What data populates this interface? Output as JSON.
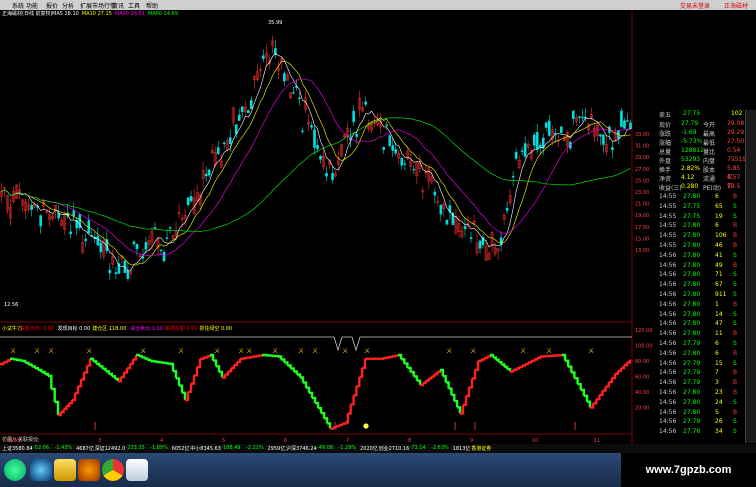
{
  "menu": {
    "items": [
      "系统",
      "功能",
      "报价",
      "分析",
      "扩展市场行情",
      "资讯",
      "工具",
      "帮助"
    ],
    "right_items": [
      "交易未登录",
      "正海磁材"
    ]
  },
  "main_chart": {
    "title": "正海磁材(日线 前复权)",
    "indicators": [
      {
        "label": "MA5 28.10",
        "color": "#ffffff"
      },
      {
        "label": "MA10 27.15",
        "color": "#ffff00"
      },
      {
        "label": "MA20 28.51",
        "color": "#ff00ff"
      },
      {
        "label": "MA60 24.69",
        "color": "#00ff00"
      }
    ],
    "high_label": "35.99",
    "low_label": "12.56",
    "price_axis": [
      "33.00",
      "31.00",
      "29.00",
      "27.00",
      "25.00",
      "23.00",
      "21.00",
      "19.00",
      "17.00",
      "15.00",
      "13.00"
    ]
  },
  "sub_chart": {
    "indicators": [
      {
        "label": "小试牛刀",
        "color": "#ffff00"
      },
      {
        "label": "没有日线: 0.00",
        "color": "#ff0000"
      },
      {
        "label": "发现目标 0.00",
        "color": "#ffffff"
      },
      {
        "label": "建仓区 118.00",
        "color": "#ffff00"
      },
      {
        "label": "减仓卖出 1.00",
        "color": "#ff00ff"
      },
      {
        "label": "离场在即 0.00",
        "color": "#ff0000"
      },
      {
        "label": "抓住绿空 0.00",
        "color": "#ffff00"
      }
    ],
    "axis": [
      "120.00",
      "100.00",
      "80.00",
      "60.00",
      "40.00",
      "20.00"
    ],
    "date_label": "2019年",
    "date_ticks": [
      "2",
      "3",
      "4",
      "5",
      "6",
      "7",
      "8",
      "9",
      "10",
      "11"
    ]
  },
  "quote": {
    "sell_row": {
      "label": "卖五",
      "price": "27.75",
      "vol": "102"
    },
    "rows": [
      {
        "l1": "现价",
        "v1": "27.79",
        "l2": "今开",
        "v2": "29.08"
      },
      {
        "l1": "涨跌",
        "v1": "-1.69",
        "l2": "最高",
        "v2": "29.29"
      },
      {
        "l1": "涨幅",
        "v1": "-5.73%",
        "l2": "最低",
        "v2": "27.50"
      },
      {
        "l1": "总量",
        "v1": "128812",
        "l2": "量比",
        "v2": "0.54"
      },
      {
        "l1": "外盘",
        "v1": "53293",
        "l2": "内盘",
        "v2": "75519"
      },
      {
        "l1": "换手",
        "v1": "2.82%",
        "l2": "股本",
        "v2": "5.85亿"
      },
      {
        "l1": "净资",
        "v1": "4.12",
        "l2": "流通",
        "v2": "4.57亿"
      },
      {
        "l1": "收益(三)",
        "v1": "0.280",
        "l2": "PE(动)",
        "v2": "74.5"
      }
    ],
    "ticks": [
      {
        "t": "14:55",
        "p": "27.80",
        "v": "6",
        "s": "B"
      },
      {
        "t": "14:55",
        "p": "27.75",
        "v": "65",
        "s": "S"
      },
      {
        "t": "14:55",
        "p": "27.75",
        "v": "19",
        "s": "S"
      },
      {
        "t": "14:55",
        "p": "27.80",
        "v": "6",
        "s": "B"
      },
      {
        "t": "14:55",
        "p": "27.80",
        "v": "106",
        "s": "B"
      },
      {
        "t": "14:55",
        "p": "27.80",
        "v": "46",
        "s": "B"
      },
      {
        "t": "14:56",
        "p": "27.80",
        "v": "41",
        "s": "S"
      },
      {
        "t": "14:56",
        "p": "27.80",
        "v": "49",
        "s": "B"
      },
      {
        "t": "14:56",
        "p": "27.80",
        "v": "71",
        "s": "S"
      },
      {
        "t": "14:56",
        "p": "27.80",
        "v": "67",
        "s": "S"
      },
      {
        "t": "14:56",
        "p": "27.80",
        "v": "911",
        "s": "S"
      },
      {
        "t": "14:56",
        "p": "27.80",
        "v": "1",
        "s": "B"
      },
      {
        "t": "14:56",
        "p": "27.80",
        "v": "14",
        "s": "S"
      },
      {
        "t": "14:56",
        "p": "27.80",
        "v": "47",
        "s": "S"
      },
      {
        "t": "14:56",
        "p": "27.80",
        "v": "11",
        "s": "B"
      },
      {
        "t": "14:56",
        "p": "27.79",
        "v": "6",
        "s": "S"
      },
      {
        "t": "14:56",
        "p": "27.80",
        "v": "6",
        "s": "B"
      },
      {
        "t": "14:56",
        "p": "27.79",
        "v": "15",
        "s": "S"
      },
      {
        "t": "14:56",
        "p": "27.79",
        "v": "7",
        "s": "B"
      },
      {
        "t": "14:56",
        "p": "27.79",
        "v": "3",
        "s": "B"
      },
      {
        "t": "14:56",
        "p": "27.80",
        "v": "23",
        "s": "B"
      },
      {
        "t": "14:56",
        "p": "27.80",
        "v": "24",
        "s": "S"
      },
      {
        "t": "14:56",
        "p": "27.80",
        "v": "5",
        "s": "B"
      },
      {
        "t": "14:56",
        "p": "27.79",
        "v": "26",
        "s": "S"
      },
      {
        "t": "14:56",
        "p": "27.76",
        "v": "34",
        "s": "S"
      }
    ]
  },
  "status_bar": {
    "items": [
      {
        "text": "上证3580.84",
        "c": "#fff"
      },
      {
        "text": "-52.06",
        "c": "#0f0"
      },
      {
        "text": "-1.43%",
        "c": "#0f0"
      },
      {
        "text": "4687亿",
        "c": "#fff"
      },
      {
        "text": "深证12492.0",
        "c": "#fff"
      },
      {
        "text": "-233.35",
        "c": "#0f0"
      },
      {
        "text": "-1.85%",
        "c": "#0f0"
      },
      {
        "text": "6052亿",
        "c": "#fff"
      },
      {
        "text": "中小8345.63",
        "c": "#fff"
      },
      {
        "text": "-188.49",
        "c": "#0f0"
      },
      {
        "text": "-2.21%",
        "c": "#0f0"
      },
      {
        "text": "2959亿",
        "c": "#fff"
      },
      {
        "text": "沪深3746.24",
        "c": "#fff"
      },
      {
        "text": "-49.08",
        "c": "#0f0"
      },
      {
        "text": "-1.29%",
        "c": "#0f0"
      },
      {
        "text": "2020亿",
        "c": "#fff"
      },
      {
        "text": "创业2710.16",
        "c": "#fff"
      },
      {
        "text": "-73.14",
        "c": "#0f0"
      },
      {
        "text": "-2.63%",
        "c": "#0f0"
      },
      {
        "text": "1813亿",
        "c": "#fff"
      },
      {
        "text": "香港证券",
        "c": "#ff0"
      }
    ]
  },
  "tabs": [
    "扩展八",
    "关联报价"
  ],
  "watermark": "www.7gpzb.com"
}
